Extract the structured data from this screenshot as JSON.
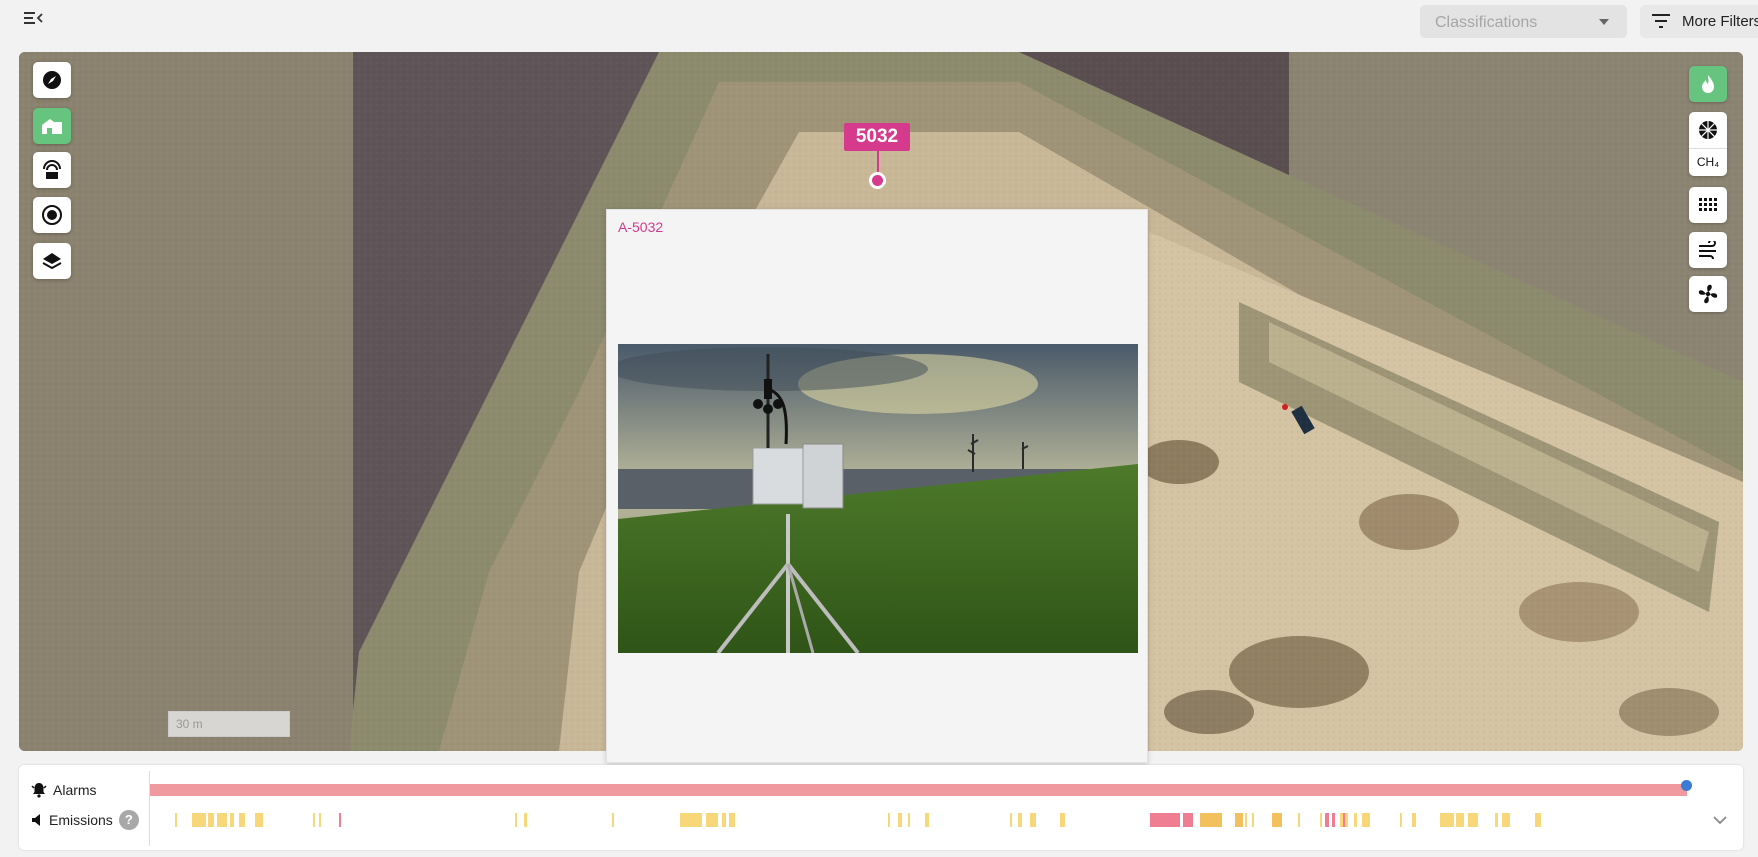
{
  "topbar": {
    "menu_icon": "menu-collapse-icon",
    "classifications": {
      "placeholder": "Classifications"
    },
    "more_filters": {
      "label": "More Filters",
      "icon": "filter-icon"
    }
  },
  "map": {
    "left_controls": [
      "compass-icon",
      "site-icon",
      "tower-icon",
      "target-icon",
      "layers-icon"
    ],
    "right_controls": [
      "flame-icon",
      "ch4-icon",
      "grid-icon",
      "wind-icon",
      "fan-icon"
    ],
    "ch4_label": "CH₄",
    "marker": {
      "label": "5032",
      "color": "#d63a8c"
    },
    "scale_label": "30 m"
  },
  "popup": {
    "title": "A-5032",
    "image_alt": "monitoring-station-photo"
  },
  "timeline": {
    "alarms_label": "Alarms",
    "emissions_label": "Emissions",
    "help": "?",
    "alarm_color": "#f0999e",
    "emission_color": "#f7d77a",
    "emission_alert_color": "#ef7e92"
  }
}
